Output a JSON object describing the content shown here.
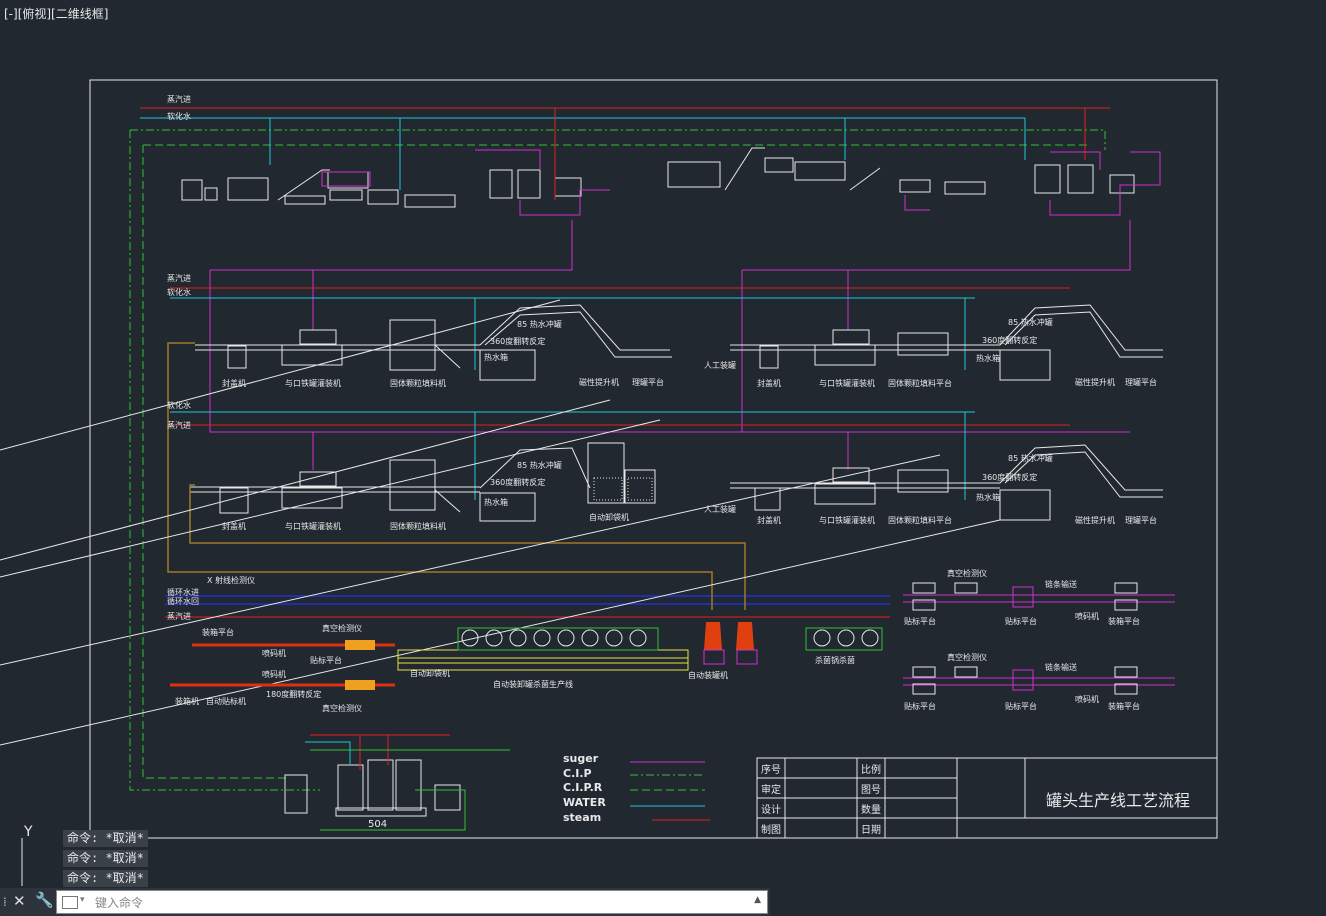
{
  "viewport": {
    "label": "[-][俯视][二维线框]"
  },
  "title_block": {
    "rows": [
      "序号",
      "审定",
      "设计",
      "制图"
    ],
    "rows2": [
      "比例",
      "图号",
      "数量",
      "日期"
    ],
    "title": "罐头生产线工艺流程"
  },
  "legend": [
    {
      "name": "suger",
      "color": "#d030d0"
    },
    {
      "name": "C.I.P",
      "color": "#30c030"
    },
    {
      "name": "C.I.P.R",
      "color": "#30c030"
    },
    {
      "name": "WATER",
      "color": "#20c8d8"
    },
    {
      "name": "steam",
      "color": "#e02020"
    }
  ],
  "labels": {
    "steam_in": "蒸汽进",
    "softened_water": "软化水",
    "rinse_360": "360度翻转反定",
    "hot_water_tank": "热水箱",
    "hot_water_rinse": "85 热水冲罐",
    "magnetic_lift": "磁性提升机",
    "manage_platform": "理罐平台",
    "weigher": "封盖机",
    "filler_a": "与口铁罐灌装机",
    "solid_filler": "固体颗粒填料机",
    "solid_platform": "固体颗粒填料平台",
    "manual_unload": "人工装罐",
    "auto_unload": "自动卸袋机",
    "xray": "X 射线检测仪",
    "cool_in": "循环水进",
    "cool_out": "循环水回",
    "steam_in2": "蒸汽进",
    "labeler_platform": "贴标平台",
    "vacuum_detect": "真空检测仪",
    "chain_conveyor": "链条输送",
    "coder": "喷码机",
    "packing_platform": "装箱平台",
    "auto_labeler": "自动贴标机",
    "rinse_180": "180度翻转反定",
    "sterilize_line": "自动装卸罐杀菌生产线",
    "auto_can": "自动装罐机",
    "sterilize_pot": "杀菌锅杀菌",
    "packer": "装箱机",
    "label_platform2": "贴标平台",
    "num504": "504"
  },
  "command": {
    "history": [
      "命令: *取消*",
      "命令: *取消*",
      "命令: *取消*"
    ],
    "placeholder": "键入命令"
  },
  "ucs": {
    "y": "Y"
  }
}
